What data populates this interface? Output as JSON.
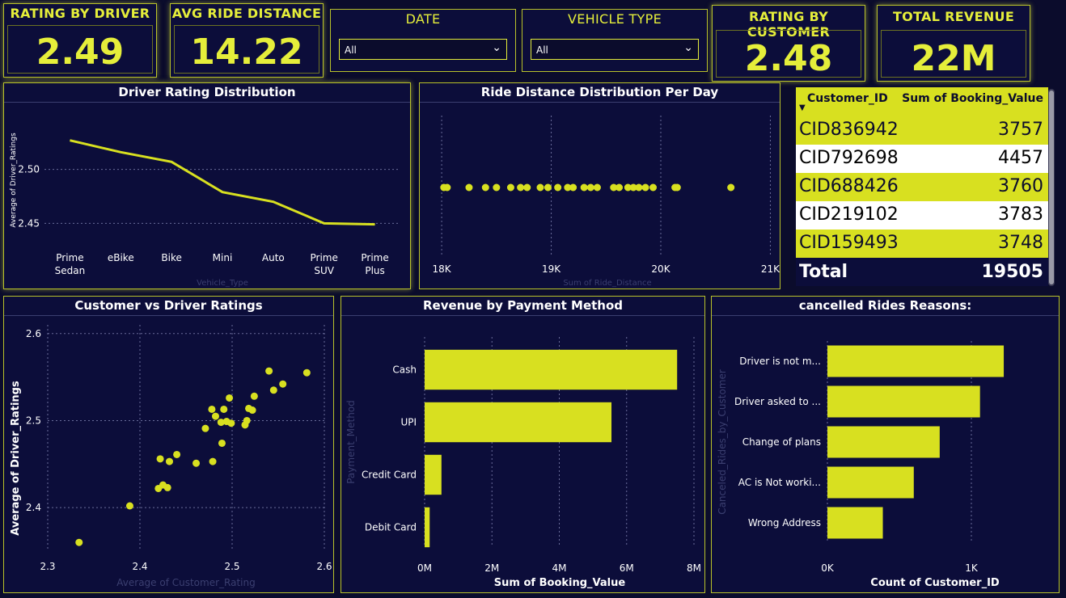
{
  "colors": {
    "accent": "#e5ee3a",
    "bar": "#d8e020",
    "background": "#0b0c2c"
  },
  "kpis": {
    "rating_driver": {
      "title": "RATING BY DRIVER",
      "value": "2.49"
    },
    "avg_distance": {
      "title": "AVG RIDE DISTANCE",
      "value": "14.22"
    },
    "rating_customer": {
      "title": "RATING BY CUSTOMER",
      "value": "2.48"
    },
    "total_revenue": {
      "title": "TOTAL REVENUE",
      "value": "22M"
    }
  },
  "slicers": {
    "date": {
      "title": "DATE",
      "value": "All",
      "icon": "chevron-down-icon"
    },
    "vehicle": {
      "title": "VEHICLE TYPE",
      "value": "All",
      "icon": "chevron-down-icon"
    }
  },
  "table": {
    "headers": [
      "Customer_ID",
      "Sum of Booking_Value"
    ],
    "sort_icon": "sort-desc-icon",
    "rows": [
      [
        "CID836942",
        "3757"
      ],
      [
        "CID792698",
        "4457"
      ],
      [
        "CID688426",
        "3760"
      ],
      [
        "CID219102",
        "3783"
      ],
      [
        "CID159493",
        "3748"
      ]
    ],
    "total_label": "Total",
    "total_value": "19505"
  },
  "chart_data": [
    {
      "id": "driver-rating",
      "type": "line",
      "title": "Driver Rating Distribution",
      "xlabel": "Vehicle_Type",
      "ylabel": "Average of Driver_Ratings",
      "categories": [
        "Prime Sedan",
        "eBike",
        "Bike",
        "Mini",
        "Auto",
        "Prime SUV",
        "Prime Plus"
      ],
      "values": [
        2.527,
        2.516,
        2.507,
        2.479,
        2.47,
        2.45,
        2.449
      ],
      "yticks": [
        "2.45",
        "2.50"
      ],
      "ylim": [
        2.43,
        2.55
      ]
    },
    {
      "id": "ride-distance",
      "type": "scatter",
      "title": "Ride Distance Distribution Per Day",
      "xlabel": "Sum of Ride_Distance",
      "xticks": [
        "18K",
        "19K",
        "20K",
        "21K"
      ],
      "xlim": [
        17800,
        21100
      ],
      "x": [
        18020,
        18050,
        18250,
        18400,
        18500,
        18630,
        18720,
        18780,
        18900,
        18970,
        19060,
        19150,
        19200,
        19300,
        19360,
        19420,
        19570,
        19620,
        19700,
        19750,
        19800,
        19860,
        19930,
        20130,
        20150,
        20640
      ]
    },
    {
      "id": "customer-vs-driver",
      "type": "scatter",
      "title": "Customer vs Driver Ratings",
      "xlabel": "Average of Customer_Rating",
      "ylabel": "Average of Driver_Ratings",
      "xticks": [
        "2.3",
        "2.4",
        "2.5",
        "2.6"
      ],
      "yticks": [
        "2.4",
        "2.5",
        "2.6"
      ],
      "xlim": [
        2.3,
        2.6
      ],
      "ylim": [
        2.35,
        2.61
      ],
      "points": [
        [
          2.334,
          2.36
        ],
        [
          2.389,
          2.402
        ],
        [
          2.42,
          2.422
        ],
        [
          2.425,
          2.426
        ],
        [
          2.43,
          2.423
        ],
        [
          2.422,
          2.456
        ],
        [
          2.432,
          2.453
        ],
        [
          2.44,
          2.461
        ],
        [
          2.461,
          2.451
        ],
        [
          2.479,
          2.453
        ],
        [
          2.471,
          2.491
        ],
        [
          2.478,
          2.513
        ],
        [
          2.482,
          2.505
        ],
        [
          2.488,
          2.498
        ],
        [
          2.491,
          2.513
        ],
        [
          2.494,
          2.499
        ],
        [
          2.497,
          2.526
        ],
        [
          2.499,
          2.497
        ],
        [
          2.489,
          2.474
        ],
        [
          2.514,
          2.495
        ],
        [
          2.516,
          2.5
        ],
        [
          2.518,
          2.514
        ],
        [
          2.522,
          2.512
        ],
        [
          2.524,
          2.528
        ],
        [
          2.54,
          2.557
        ],
        [
          2.545,
          2.535
        ],
        [
          2.555,
          2.542
        ],
        [
          2.581,
          2.555
        ]
      ]
    },
    {
      "id": "revenue-payment",
      "type": "bar",
      "title": "Revenue by Payment Method",
      "xlabel": "Sum of Booking_Value",
      "ylabel": "Payment_Method",
      "categories": [
        "Cash",
        "UPI",
        "Credit Card",
        "Debit Card"
      ],
      "values": [
        7.5,
        5.55,
        0.5,
        0.15
      ],
      "xticks": [
        "0M",
        "2M",
        "4M",
        "6M",
        "8M"
      ],
      "xlim": [
        0,
        8
      ]
    },
    {
      "id": "cancelled-reasons",
      "type": "bar",
      "title": "cancelled Rides Reasons:",
      "xlabel": "Count of Customer_ID",
      "ylabel": "Canceled_Rides_by_Customer",
      "categories": [
        "Driver is not m...",
        "Driver asked to ...",
        "Change of plans",
        "AC is Not worki...",
        "Wrong Address"
      ],
      "values": [
        1225,
        1060,
        780,
        600,
        385
      ],
      "xticks": [
        "0K",
        "1K"
      ],
      "xlim": [
        0,
        1000
      ]
    }
  ]
}
